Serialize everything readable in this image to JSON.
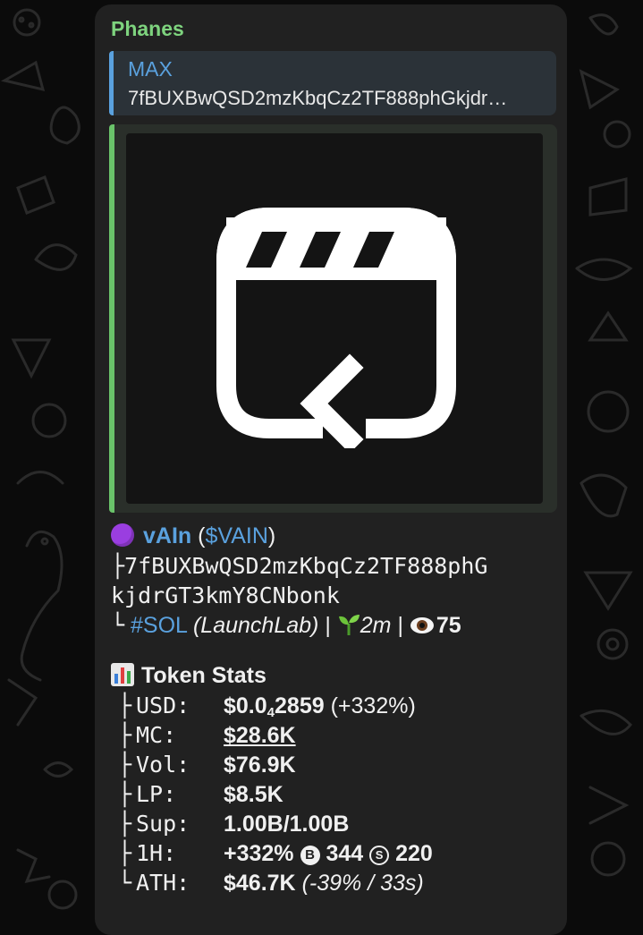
{
  "sender": "Phanes",
  "reply": {
    "name": "MAX",
    "text": "7fBUXBwQSD2mzKbqCz2TF888phGkjdr…"
  },
  "token": {
    "emoji": "purple-circle-icon",
    "name": "vAIn",
    "ticker_open": "(",
    "ticker": "$VAIN",
    "ticker_close": ")",
    "tree_branch": "├",
    "address_line1": "7fBUXBwQSD2mzKbqCz2TF888phG",
    "address_line2": "kjdrGT3kmY8CNbonk",
    "tree_end": "└",
    "chain": "#SOL",
    "launchpad": "(LaunchLab)",
    "sep1": " | ",
    "age": "2m",
    "sep2": " | ",
    "views": "75"
  },
  "stats": {
    "header": "Token Stats",
    "usd": {
      "label": "USD:",
      "value_prefix": "$0.0",
      "value_sub": "4",
      "value_rest": "2859",
      "change": " (+332%)"
    },
    "mc": {
      "label": "MC:",
      "value": "$28.6K"
    },
    "vol": {
      "label": "Vol:",
      "value": "$76.9K"
    },
    "lp": {
      "label": "LP:",
      "value": "$8.5K"
    },
    "sup": {
      "label": "Sup:",
      "value": "1.00B/1.00B"
    },
    "h1": {
      "label": "1H:",
      "change": "+332%",
      "buys_icon": "B",
      "buys": "344",
      "sells_icon": "S",
      "sells": "220"
    },
    "ath": {
      "label": "ATH:",
      "value": "$46.7K",
      "detail": "(-39% / 33s)"
    }
  },
  "colors": {
    "sender": "#7ed37e",
    "link": "#5aa1de",
    "reply_bar": "#5aa1de",
    "preview_bar": "#6ac36a",
    "bubble": "#212121"
  }
}
